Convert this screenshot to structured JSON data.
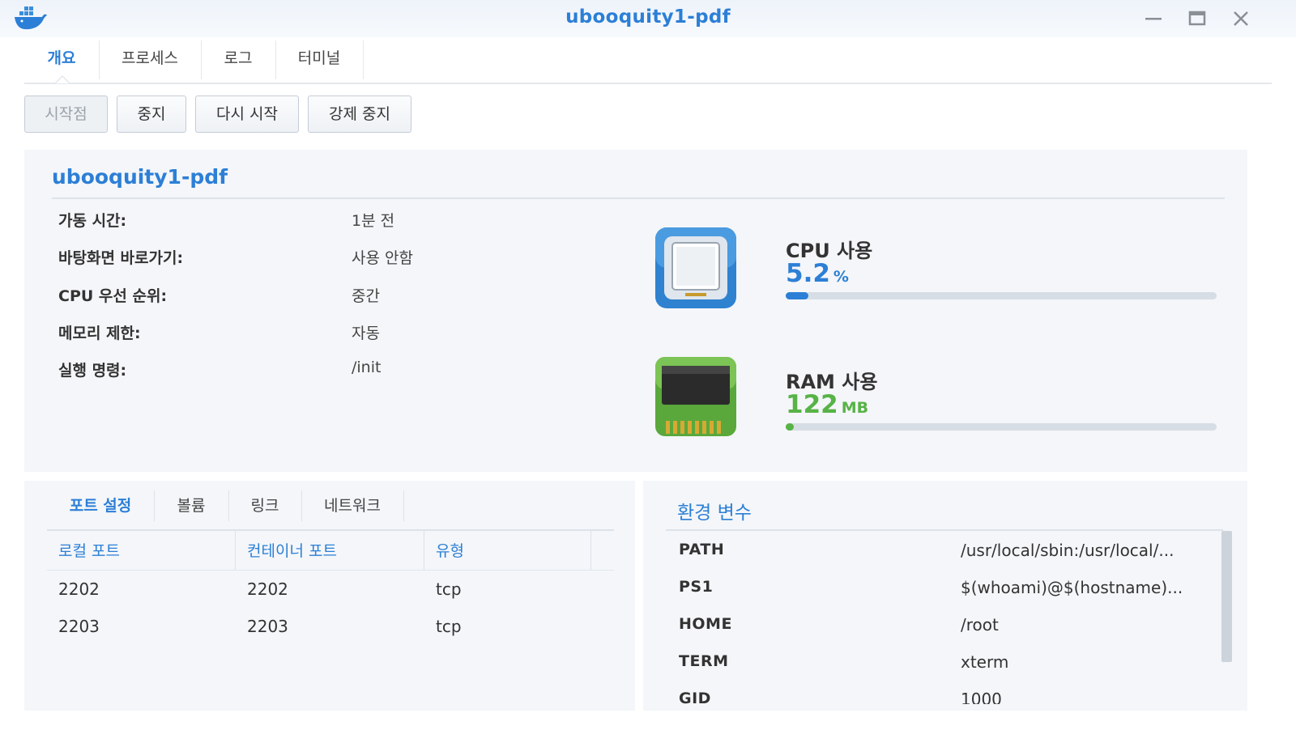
{
  "window": {
    "title": "ubooquity1-pdf",
    "app_icon": "docker-whale-icon",
    "controls": [
      "minimize-icon",
      "maximize-icon",
      "close-icon"
    ]
  },
  "tabs": [
    {
      "label": "개요",
      "active": true
    },
    {
      "label": "프로세스",
      "active": false
    },
    {
      "label": "로그",
      "active": false
    },
    {
      "label": "터미널",
      "active": false
    }
  ],
  "actions": {
    "start": "시작점",
    "stop": "중지",
    "restart": "다시 시작",
    "force_stop": "강제 중지"
  },
  "summary": {
    "title": "ubooquity1-pdf",
    "rows": [
      {
        "label": "가동 시간:",
        "value": "1분 전"
      },
      {
        "label": "바탕화면 바로가기:",
        "value": "사용 안함"
      },
      {
        "label": "CPU 우선 순위:",
        "value": "중간"
      },
      {
        "label": "메모리 제한:",
        "value": "자동"
      },
      {
        "label": "실행 명령:",
        "value": "/init"
      }
    ]
  },
  "resources": {
    "cpu": {
      "title": "CPU 사용",
      "value": "5.2",
      "unit": "%",
      "usage_fraction": 0.052,
      "color": "#2c7fd6",
      "icon": "cpu-chip-icon"
    },
    "ram": {
      "title": "RAM 사용",
      "value": "122",
      "unit": "MB",
      "usage_fraction": 0.015,
      "color": "#57b346",
      "icon": "ram-module-icon"
    }
  },
  "subtabs": [
    {
      "label": "포트 설정",
      "active": true
    },
    {
      "label": "볼륨",
      "active": false
    },
    {
      "label": "링크",
      "active": false
    },
    {
      "label": "네트워크",
      "active": false
    }
  ],
  "ports": {
    "columns": [
      "로컬 포트",
      "컨테이너 포트",
      "유형"
    ],
    "rows": [
      [
        "2202",
        "2202",
        "tcp"
      ],
      [
        "2203",
        "2203",
        "tcp"
      ]
    ]
  },
  "env": {
    "title": "환경 변수",
    "rows": [
      {
        "key": "PATH",
        "value": "/usr/local/sbin:/usr/local/..."
      },
      {
        "key": "PS1",
        "value": "$(whoami)@$(hostname)..."
      },
      {
        "key": "HOME",
        "value": "/root"
      },
      {
        "key": "TERM",
        "value": "xterm"
      },
      {
        "key": "GID",
        "value": "1000"
      }
    ]
  },
  "colors": {
    "accent": "#2c7fd6",
    "ram_green": "#57b346",
    "panel_bg": "#f4f6f9"
  }
}
